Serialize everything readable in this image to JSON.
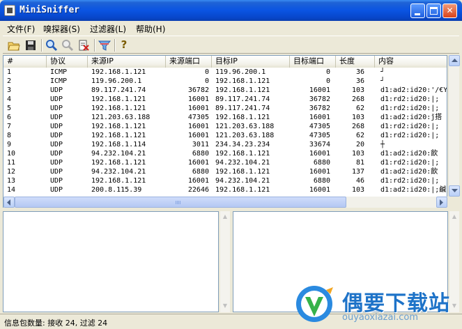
{
  "window": {
    "title": "MiniSniffer",
    "min_label": "",
    "max_label": "",
    "close_label": "✕"
  },
  "menu": [
    "文件(F)",
    "嗅探器(S)",
    "过滤器(L)",
    "帮助(H)"
  ],
  "toolbar": [
    {
      "icon": "open-folder-icon"
    },
    {
      "icon": "save-icon"
    },
    {
      "icon": "start-sniff-icon"
    },
    {
      "icon": "stop-sniff-icon"
    },
    {
      "icon": "clear-icon"
    },
    {
      "icon": "filter-icon"
    },
    {
      "icon": "help-icon",
      "glyph": "?"
    }
  ],
  "columns": [
    "#",
    "协议",
    "来源IP",
    "来源端口",
    "目标IP",
    "目标端口",
    "长度",
    "内容"
  ],
  "rows": [
    [
      "1",
      "ICMP",
      "192.168.1.121",
      "0",
      "119.96.200.1",
      "0",
      "36",
      "┘"
    ],
    [
      "2",
      "ICMP",
      "119.96.200.1",
      "0",
      "192.168.1.121",
      "0",
      "36",
      "┘"
    ],
    [
      "3",
      "UDP",
      "89.117.241.74",
      "36782",
      "192.168.1.121",
      "16001",
      "103",
      "d1:ad2:id20:'/€Y"
    ],
    [
      "4",
      "UDP",
      "192.168.1.121",
      "16001",
      "89.117.241.74",
      "36782",
      "268",
      "d1:rd2:id20:|;"
    ],
    [
      "5",
      "UDP",
      "192.168.1.121",
      "16001",
      "89.117.241.74",
      "36782",
      "62",
      "d1:rd2:id20:|;"
    ],
    [
      "6",
      "UDP",
      "121.203.63.188",
      "47305",
      "192.168.1.121",
      "16001",
      "103",
      "d1:ad2:id20:ǰ搭"
    ],
    [
      "7",
      "UDP",
      "192.168.1.121",
      "16001",
      "121.203.63.188",
      "47305",
      "268",
      "d1:rd2:id20:|;"
    ],
    [
      "8",
      "UDP",
      "192.168.1.121",
      "16001",
      "121.203.63.188",
      "47305",
      "62",
      "d1:rd2:id20:|;"
    ],
    [
      "9",
      "UDP",
      "192.168.1.114",
      "3011",
      "234.34.23.234",
      "33674",
      "20",
      "┼"
    ],
    [
      "10",
      "UDP",
      "94.232.104.21",
      "6880",
      "192.168.1.121",
      "16001",
      "103",
      "d1:ad2:id20:飲"
    ],
    [
      "11",
      "UDP",
      "192.168.1.121",
      "16001",
      "94.232.104.21",
      "6880",
      "81",
      "d1:rd2:id20:|;"
    ],
    [
      "12",
      "UDP",
      "94.232.104.21",
      "6880",
      "192.168.1.121",
      "16001",
      "137",
      "d1:ad2:id20:飲"
    ],
    [
      "13",
      "UDP",
      "192.168.1.121",
      "16001",
      "94.232.104.21",
      "6880",
      "46",
      "d1:rd2:id20:|;"
    ],
    [
      "14",
      "UDP",
      "200.8.115.39",
      "22646",
      "192.168.1.121",
      "16001",
      "103",
      "d1:ad2:id20:|;鹹"
    ]
  ],
  "status": "信息包数量: 接收 24, 过滤 24",
  "watermark": {
    "title": "偶要下载站",
    "url": "ouyaoxiazai.com"
  }
}
